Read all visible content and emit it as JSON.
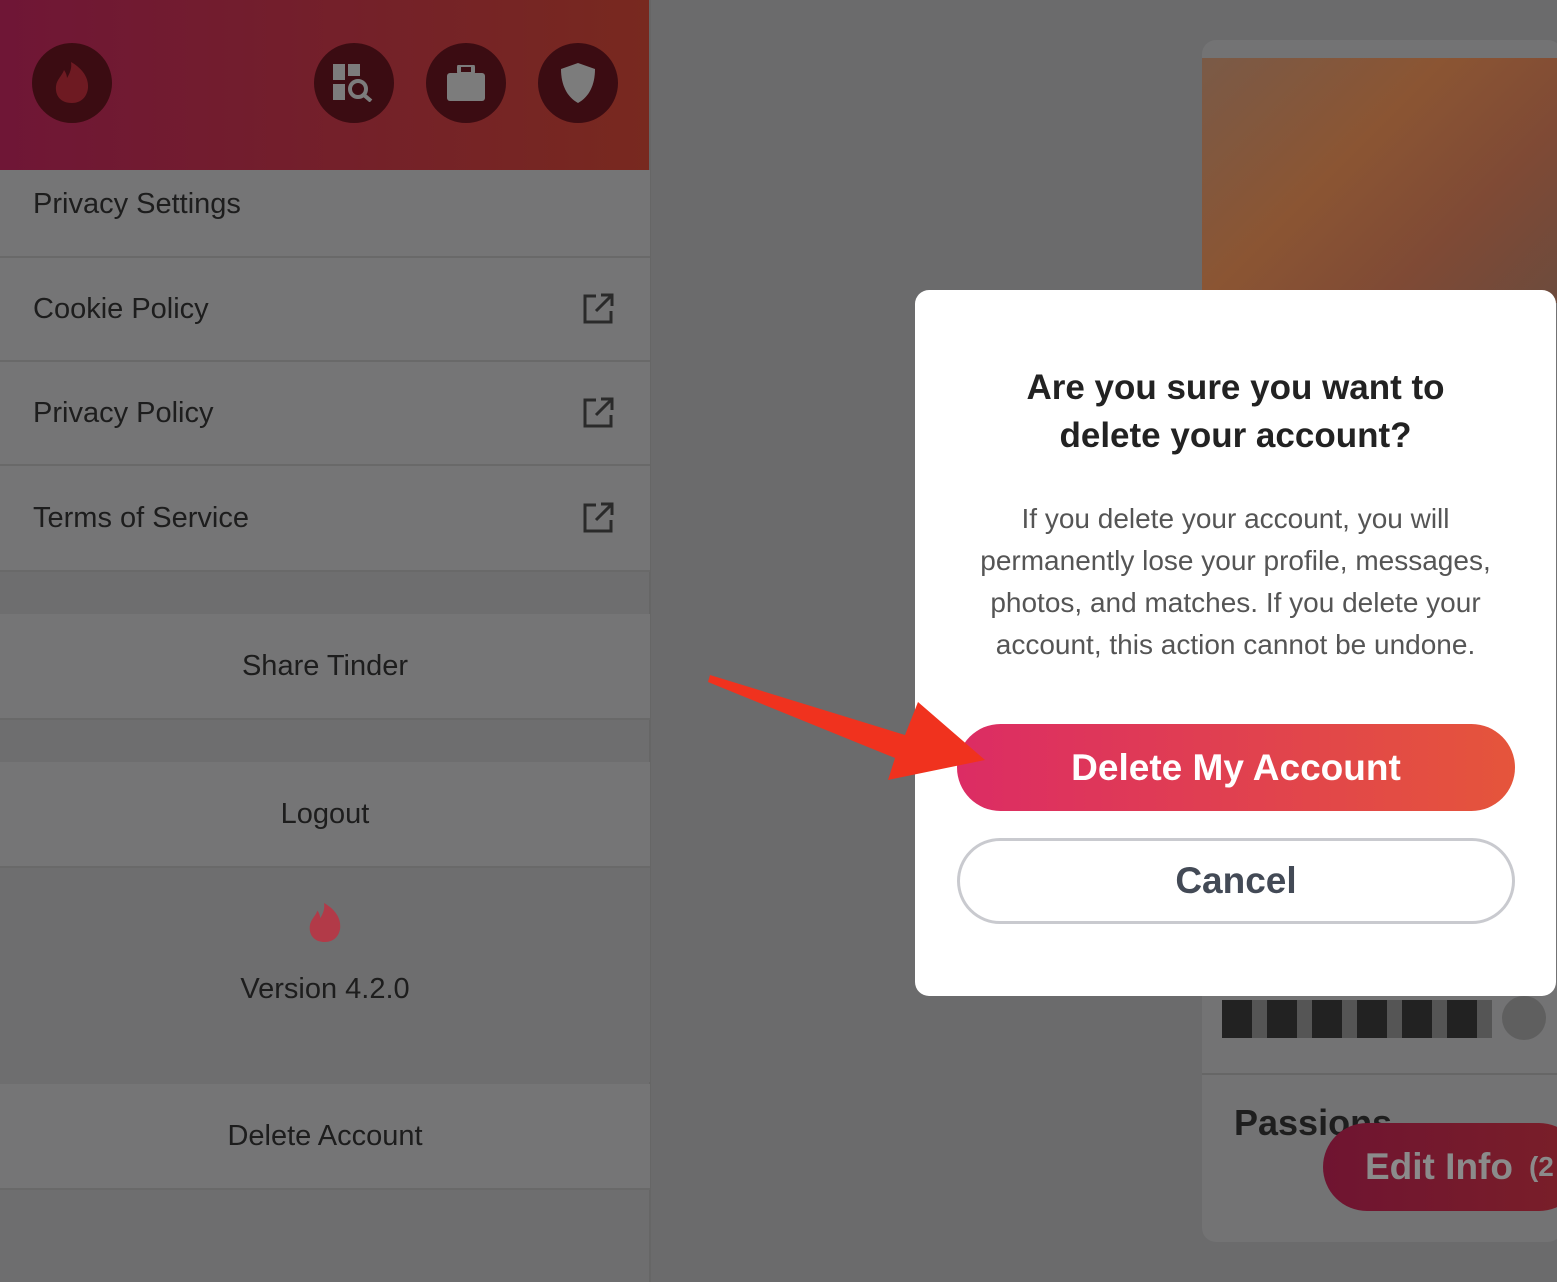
{
  "header": {
    "icons": [
      "tinder-flame-icon",
      "explore-icon",
      "briefcase-icon",
      "shield-icon"
    ]
  },
  "menu": {
    "privacy_settings": "Privacy Settings",
    "cookie_policy": "Cookie Policy",
    "privacy_policy": "Privacy Policy",
    "terms": "Terms of Service",
    "share": "Share Tinder",
    "logout": "Logout",
    "version": "Version 4.2.0",
    "delete_account": "Delete Account"
  },
  "profile": {
    "section": "Passions",
    "edit_button": "Edit Info",
    "edit_count": "(2"
  },
  "modal": {
    "title": "Are you sure you want to delete your account?",
    "body": "If you delete your account, you will permanently lose your profile, messages, photos, and matches. If you delete your account, this action cannot be undone.",
    "delete_label": "Delete My Account",
    "cancel_label": "Cancel"
  },
  "colors": {
    "accent_start": "#dc2c64",
    "accent_end": "#e5553b",
    "arrow": "#f0321e"
  }
}
